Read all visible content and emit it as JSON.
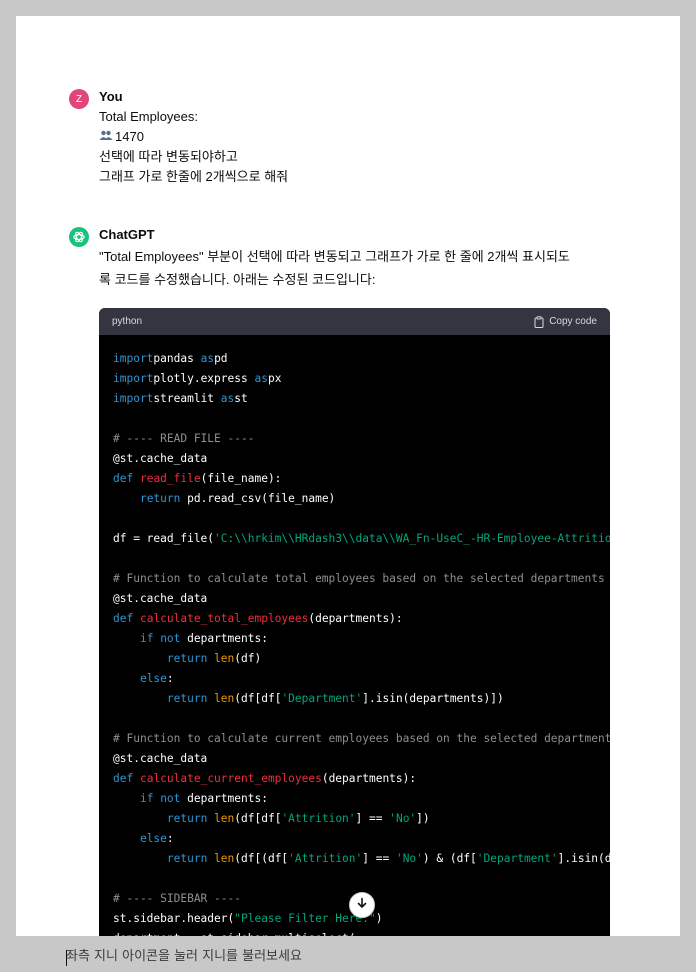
{
  "user_message": {
    "avatar_letter": "Z",
    "sender": "You",
    "lines": [
      "Total Employees:",
      "1470",
      "선택에 따라 변동되야하고",
      "그래프 가로 한줄에 2개씩으로 해줘"
    ]
  },
  "assistant_message": {
    "sender": "ChatGPT",
    "lines": [
      "\"Total Employees\" 부분이 선택에 따라 변동되고 그래프가 가로 한 줄에 2개씩 표시되도",
      "록 코드를 수정했습니다. 아래는 수정된 코드입니다:"
    ]
  },
  "code_block": {
    "language": "python",
    "copy_label": "Copy code",
    "lines": [
      [
        [
          "kw",
          "import"
        ],
        [
          "",
          "pandas "
        ],
        [
          "kw",
          "as"
        ],
        [
          "",
          "pd"
        ]
      ],
      [
        [
          "kw",
          "import"
        ],
        [
          "",
          "plotly.express "
        ],
        [
          "kw",
          "as"
        ],
        [
          "",
          "px"
        ]
      ],
      [
        [
          "kw",
          "import"
        ],
        [
          "",
          "streamlit "
        ],
        [
          "kw",
          "as"
        ],
        [
          "",
          "st"
        ]
      ],
      [],
      [
        [
          "cm",
          "# ---- READ FILE ----"
        ]
      ],
      [
        [
          "",
          "@st.cache_data"
        ]
      ],
      [
        [
          "kw",
          "def"
        ],
        [
          "",
          " "
        ],
        [
          "fn",
          "read_file"
        ],
        [
          "",
          "(file_name):"
        ]
      ],
      [
        [
          "",
          "    "
        ],
        [
          "kw",
          "return"
        ],
        [
          "",
          " pd.read_csv(file_name)"
        ]
      ],
      [],
      [
        [
          "",
          "df = read_file("
        ],
        [
          "str",
          "'C:\\\\hrkim\\\\HRdash3\\\\data\\\\WA_Fn-UseC_-HR-Employee-Attrition.csv'"
        ],
        [
          "",
          ")"
        ]
      ],
      [],
      [
        [
          "cm",
          "# Function to calculate total employees based on the selected departments"
        ]
      ],
      [
        [
          "",
          "@st.cache_data"
        ]
      ],
      [
        [
          "kw",
          "def"
        ],
        [
          "",
          " "
        ],
        [
          "fn",
          "calculate_total_employees"
        ],
        [
          "",
          "(departments):"
        ]
      ],
      [
        [
          "",
          "    "
        ],
        [
          "kw",
          "if"
        ],
        [
          "",
          " "
        ],
        [
          "kw",
          "not"
        ],
        [
          "",
          " departments:"
        ]
      ],
      [
        [
          "",
          "        "
        ],
        [
          "kw",
          "return"
        ],
        [
          "",
          " "
        ],
        [
          "bo",
          "len"
        ],
        [
          "",
          "(df)"
        ]
      ],
      [
        [
          "",
          "    "
        ],
        [
          "kw",
          "else"
        ],
        [
          "",
          ":"
        ]
      ],
      [
        [
          "",
          "        "
        ],
        [
          "kw",
          "return"
        ],
        [
          "",
          " "
        ],
        [
          "bo",
          "len"
        ],
        [
          "",
          "(df[df["
        ],
        [
          "str",
          "'Department'"
        ],
        [
          "",
          "].isin(departments)])"
        ]
      ],
      [],
      [
        [
          "cm",
          "# Function to calculate current employees based on the selected departments"
        ]
      ],
      [
        [
          "",
          "@st.cache_data"
        ]
      ],
      [
        [
          "kw",
          "def"
        ],
        [
          "",
          " "
        ],
        [
          "fn",
          "calculate_current_employees"
        ],
        [
          "",
          "(departments):"
        ]
      ],
      [
        [
          "",
          "    "
        ],
        [
          "kw",
          "if"
        ],
        [
          "",
          " "
        ],
        [
          "kw",
          "not"
        ],
        [
          "",
          " departments:"
        ]
      ],
      [
        [
          "",
          "        "
        ],
        [
          "kw",
          "return"
        ],
        [
          "",
          " "
        ],
        [
          "bo",
          "len"
        ],
        [
          "",
          "(df[df["
        ],
        [
          "str",
          "'Attrition'"
        ],
        [
          "",
          "] == "
        ],
        [
          "str",
          "'No'"
        ],
        [
          "",
          "])"
        ]
      ],
      [
        [
          "",
          "    "
        ],
        [
          "kw",
          "else"
        ],
        [
          "",
          ":"
        ]
      ],
      [
        [
          "",
          "        "
        ],
        [
          "kw",
          "return"
        ],
        [
          "",
          " "
        ],
        [
          "bo",
          "len"
        ],
        [
          "",
          "(df[(df["
        ],
        [
          "str",
          "'Attrition'"
        ],
        [
          "",
          "] == "
        ],
        [
          "str",
          "'No'"
        ],
        [
          "",
          ") & (df["
        ],
        [
          "str",
          "'Department'"
        ],
        [
          "",
          "].isin(departments))])"
        ]
      ],
      [],
      [
        [
          "cm",
          "# ---- SIDEBAR ----"
        ]
      ],
      [
        [
          "",
          "st.sidebar.header("
        ],
        [
          "str",
          "\"Please Filter Here:\""
        ],
        [
          "",
          ")"
        ]
      ],
      [
        [
          "",
          "department = st.sidebar.multiselect("
        ]
      ]
    ]
  },
  "bottom_input": {
    "placeholder": "좌측 지니 아이콘을 눌러 지니를 불러보세요"
  },
  "icons": {
    "people": "people-icon",
    "copy": "clipboard-icon",
    "scroll": "arrow-down-icon",
    "gpt_logo": "openai-logo-icon"
  },
  "colors": {
    "user_avatar": "#e0457b",
    "gpt_avatar": "#19c37d",
    "code_bg": "#000000",
    "code_header": "#343541"
  }
}
